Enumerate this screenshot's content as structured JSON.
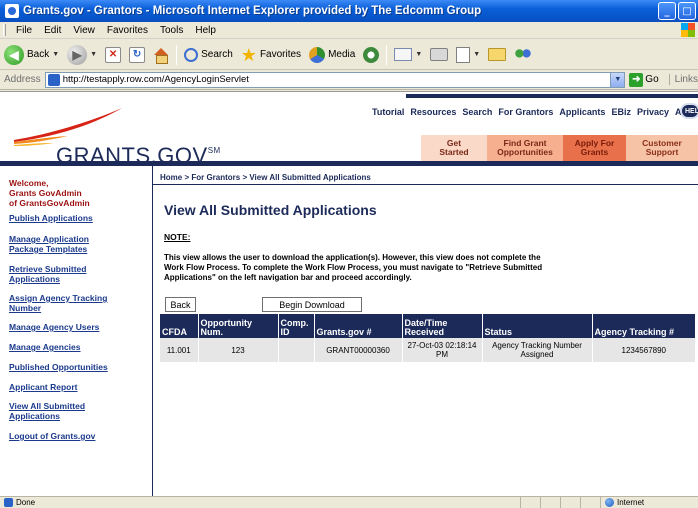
{
  "window": {
    "title": "Grants.gov - Grantors - Microsoft Internet Explorer provided by The Edcomm Group"
  },
  "menu": [
    "File",
    "Edit",
    "View",
    "Favorites",
    "Tools",
    "Help"
  ],
  "toolbar": {
    "back_label": "Back",
    "search_label": "Search",
    "favorites_label": "Favorites",
    "media_label": "Media"
  },
  "address": {
    "label": "Address",
    "url": "http://testapply.row.com/AgencyLoginServlet",
    "go_label": "Go",
    "links_label": "Links"
  },
  "site": {
    "brand": "GRANTS.GOV",
    "brand_mark": "SM",
    "utility_nav": [
      "Tutorial",
      "Resources",
      "Search",
      "For Grantors",
      "Applicants",
      "EBiz",
      "Privacy",
      "About Us"
    ],
    "help_label": "HEL",
    "tabs": [
      {
        "line1": "Get",
        "line2": "Started"
      },
      {
        "line1": "Find Grant",
        "line2": "Opportunities"
      },
      {
        "line1": "Apply For",
        "line2": "Grants"
      },
      {
        "line1": "Customer",
        "line2": "Support"
      }
    ]
  },
  "sidebar": {
    "welcome": [
      "Welcome,",
      "Grants GovAdmin",
      "of GrantsGovAdmin"
    ],
    "links": [
      [
        "Publish Applications"
      ],
      [
        "Manage Application",
        "Package Templates"
      ],
      [
        "Retrieve Submitted",
        "Applications"
      ],
      [
        "Assign Agency Tracking",
        "Number"
      ],
      [
        "Manage Agency Users"
      ],
      [
        "Manage Agencies"
      ],
      [
        "Published Opportunities"
      ],
      [
        "Applicant Report"
      ],
      [
        "View All Submitted",
        "Applications"
      ],
      [
        "Logout of Grants.gov"
      ]
    ]
  },
  "content": {
    "breadcrumb": "Home > For Grantors > View All Submitted Applications",
    "title": "View All Submitted Applications",
    "note_label": "NOTE:",
    "note_lines": [
      "This view allows the user to download the application(s). However, this view does not complete the",
      "Work Flow Process. To complete the Work Flow Process, you must navigate to \"Retrieve Submitted",
      "Applications\" on the left navigation bar and proceed accordingly."
    ],
    "back_button": "Back",
    "download_button": "Begin Download",
    "table": {
      "headers": [
        [
          "CFDA"
        ],
        [
          "Opportunity",
          "Num."
        ],
        [
          "Comp.",
          "ID"
        ],
        [
          "Grants.gov #"
        ],
        [
          "Date/Time",
          "Received"
        ],
        [
          "Status"
        ],
        [
          "Agency Tracking #"
        ]
      ],
      "rows": [
        [
          "11.001",
          "123",
          "",
          "GRANT00000360",
          "27-Oct-03 02:18:14 PM",
          "Agency Tracking Number Assigned",
          "1234567890"
        ]
      ]
    }
  },
  "status": {
    "text": "Done",
    "zone": "Internet"
  },
  "colors": {
    "navy": "#1b2a58",
    "welcome_red": "#9b1111",
    "link_blue": "#1b3a8c",
    "row_gray": "#e6e6e6"
  }
}
